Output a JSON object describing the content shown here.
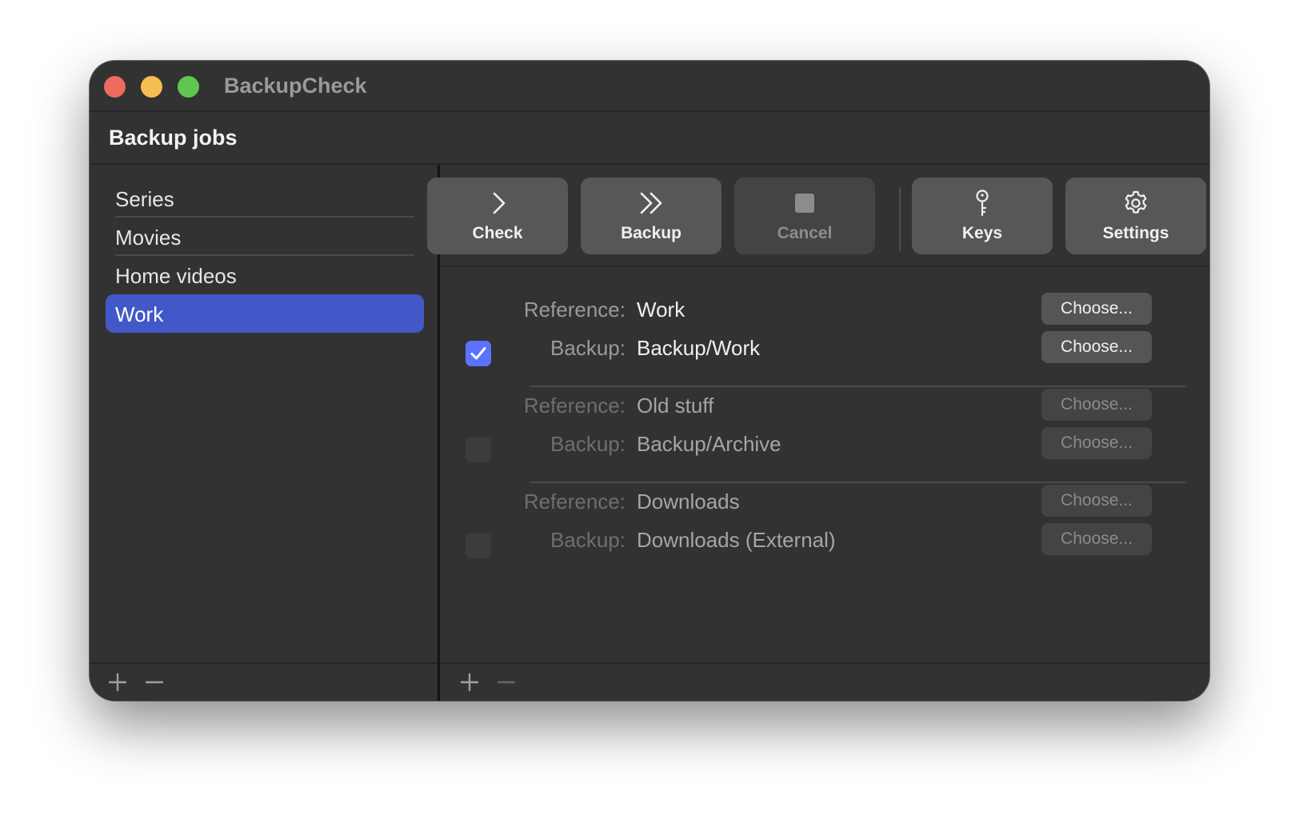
{
  "window": {
    "title": "BackupCheck"
  },
  "section": {
    "title": "Backup jobs"
  },
  "sidebar": {
    "items": [
      {
        "label": "Series",
        "selected": false
      },
      {
        "label": "Movies",
        "selected": false
      },
      {
        "label": "Home videos",
        "selected": false
      },
      {
        "label": "Work",
        "selected": true
      }
    ],
    "add_icon": "plus-icon",
    "remove_icon": "minus-icon"
  },
  "toolbar": {
    "check_label": "Check",
    "backup_label": "Backup",
    "cancel_label": "Cancel",
    "keys_label": "Keys",
    "settings_label": "Settings"
  },
  "pairs": [
    {
      "enabled": true,
      "reference_key": "Reference:",
      "reference_value": "Work",
      "backup_key": "Backup:",
      "backup_value": "Backup/Work",
      "choose_label": "Choose..."
    },
    {
      "enabled": false,
      "reference_key": "Reference:",
      "reference_value": "Old stuff",
      "backup_key": "Backup:",
      "backup_value": "Backup/Archive",
      "choose_label": "Choose..."
    },
    {
      "enabled": false,
      "reference_key": "Reference:",
      "reference_value": "Downloads",
      "backup_key": "Backup:",
      "backup_value": "Downloads (External)",
      "choose_label": "Choose..."
    }
  ],
  "colors": {
    "accent": "#4358c8",
    "checkbox": "#5a73ff",
    "window_bg": "#323232"
  }
}
